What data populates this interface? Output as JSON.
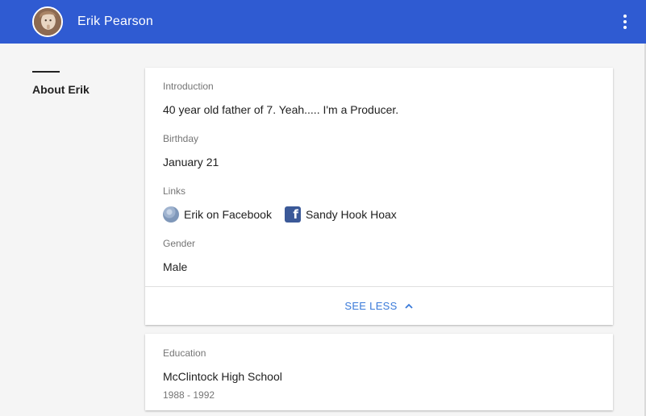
{
  "header": {
    "name": "Erik Pearson",
    "menu_icon": "more-vert-icon",
    "accent": "#2f5bd2"
  },
  "left_nav": {
    "label": "About Erik"
  },
  "about": {
    "intro_label": "Introduction",
    "intro_value": "40 year old father of 7. Yeah..... I'm a Producer.",
    "birthday_label": "Birthday",
    "birthday_value": "January 21",
    "links_label": "Links",
    "links": [
      {
        "text": "Erik on Facebook",
        "icon": "globe-icon"
      },
      {
        "text": "Sandy Hook Hoax",
        "icon": "facebook-icon"
      }
    ],
    "gender_label": "Gender",
    "gender_value": "Male",
    "toggle_label": "SEE LESS",
    "toggle_icon": "chevron-up-icon"
  },
  "education": {
    "label": "Education",
    "school": "McClintock High School",
    "years": "1988 - 1992"
  }
}
